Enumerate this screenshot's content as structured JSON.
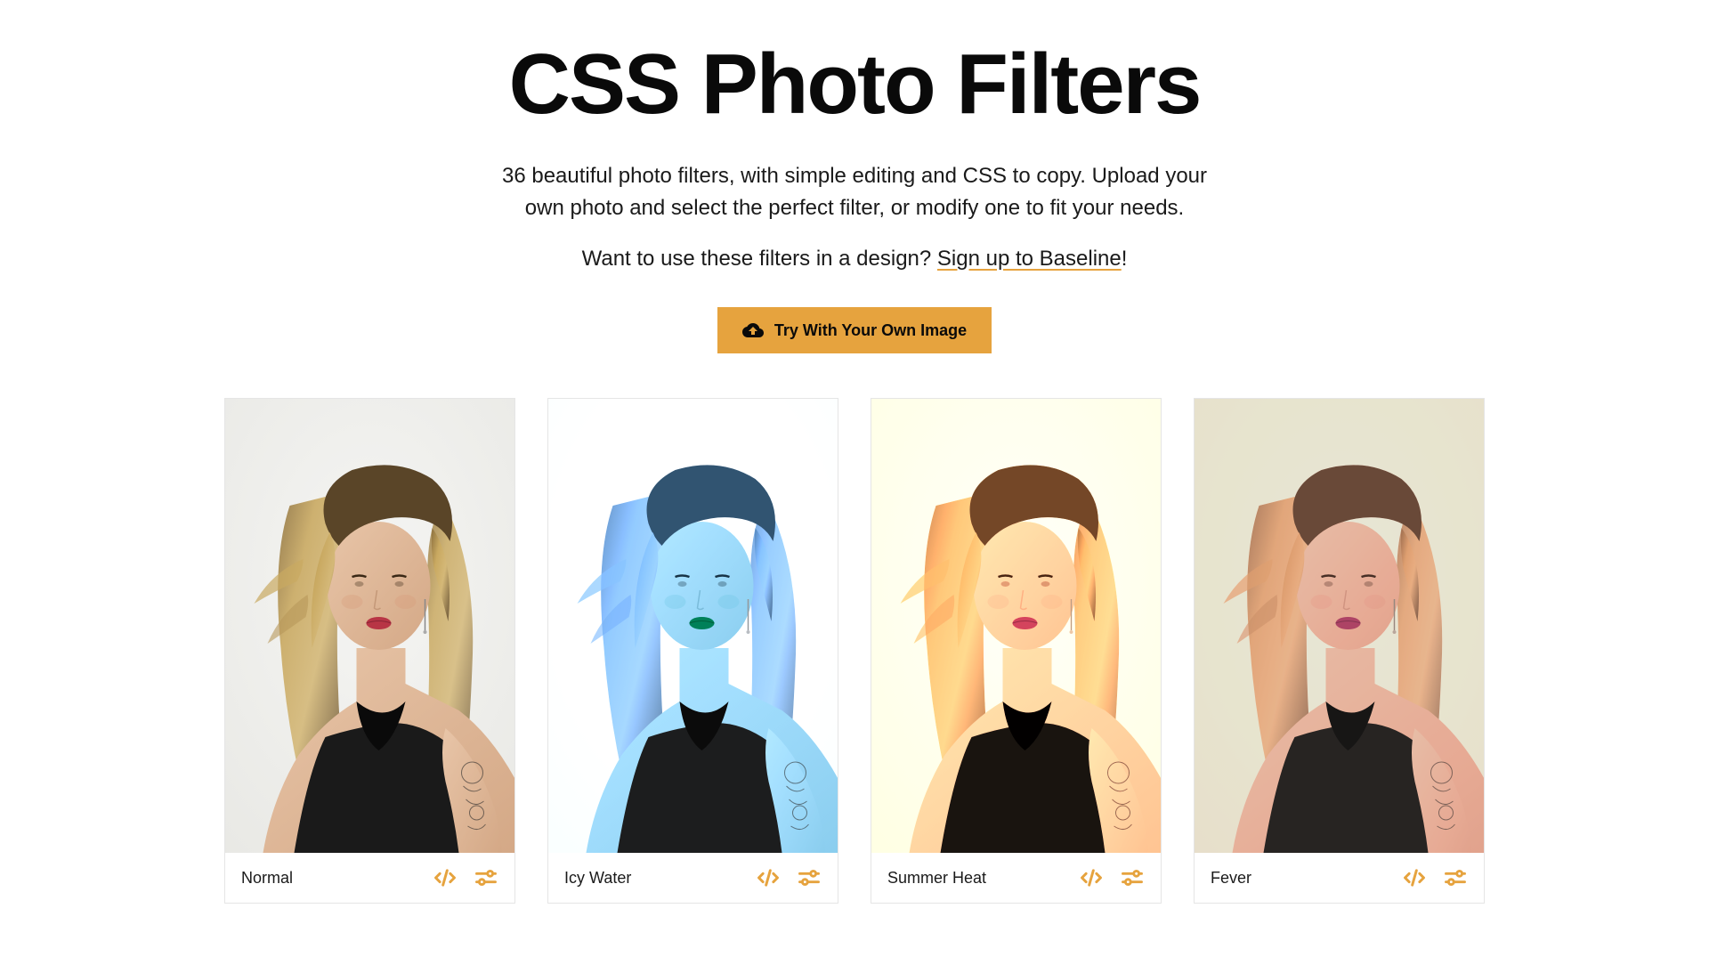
{
  "header": {
    "title": "CSS Photo Filters",
    "subtitle": "36 beautiful photo filters, with simple editing and CSS to copy. Upload your own photo and select the perfect filter, or modify one to fit your needs.",
    "cta_prefix": "Want to use these filters in a design? ",
    "cta_link": "Sign up to Baseline",
    "cta_suffix": "!",
    "upload_button": "Try With Your Own Image"
  },
  "filters": [
    {
      "name": "Normal",
      "filter_class": "filter-normal"
    },
    {
      "name": "Icy Water",
      "filter_class": "filter-icy-water"
    },
    {
      "name": "Summer Heat",
      "filter_class": "filter-summer-heat"
    },
    {
      "name": "Fever",
      "filter_class": "filter-fever"
    }
  ],
  "colors": {
    "accent": "#e6a33e"
  }
}
